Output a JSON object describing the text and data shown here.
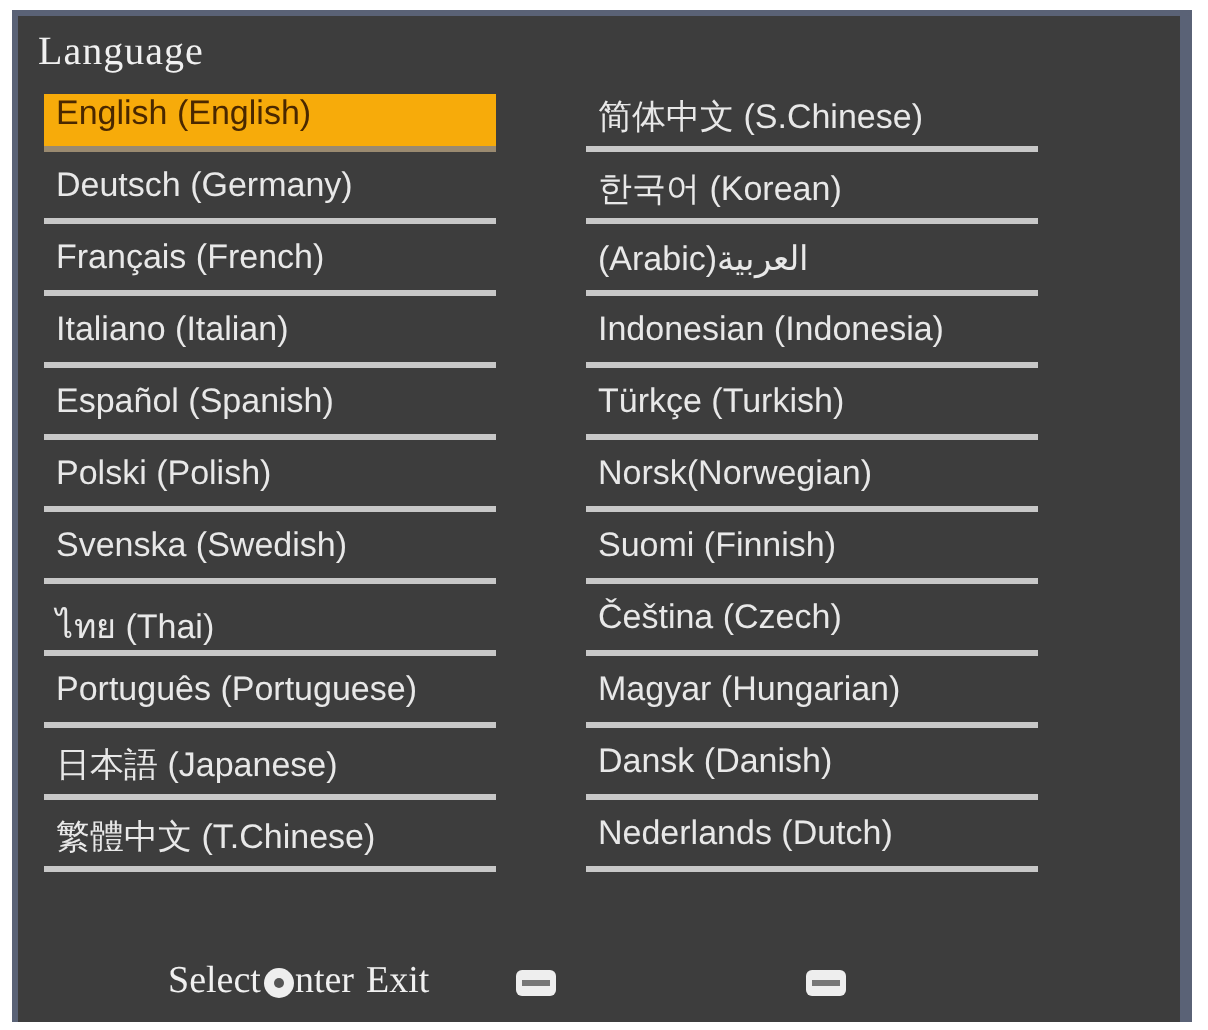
{
  "window": {
    "title": "Language"
  },
  "columns": [
    {
      "items": [
        {
          "label": "English (English)",
          "selected": true
        },
        {
          "label": "Deutsch (Germany)",
          "selected": false
        },
        {
          "label": "Français (French)",
          "selected": false
        },
        {
          "label": "Italiano (Italian)",
          "selected": false
        },
        {
          "label": "Español (Spanish)",
          "selected": false
        },
        {
          "label": "Polski (Polish)",
          "selected": false
        },
        {
          "label": "Svenska (Swedish)",
          "selected": false
        },
        {
          "label": "ไทย (Thai)",
          "selected": false
        },
        {
          "label": "Português (Portuguese)",
          "selected": false
        },
        {
          "label": "日本語 (Japanese)",
          "selected": false
        },
        {
          "label": "繁體中文 (T.Chinese)",
          "selected": false
        }
      ]
    },
    {
      "items": [
        {
          "label": "简体中文 (S.Chinese)",
          "selected": false
        },
        {
          "label": "한국어 (Korean)",
          "selected": false
        },
        {
          "label": "(Arabic)العربية",
          "selected": false
        },
        {
          "label": "Indonesian (Indonesia)",
          "selected": false
        },
        {
          "label": "Türkçe (Turkish)",
          "selected": false
        },
        {
          "label": "Norsk(Norwegian)",
          "selected": false
        },
        {
          "label": "Suomi (Finnish)",
          "selected": false
        },
        {
          "label": "Čeština (Czech)",
          "selected": false
        },
        {
          "label": "Magyar (Hungarian)",
          "selected": false
        },
        {
          "label": "Dansk (Danish)",
          "selected": false
        },
        {
          "label": "Nederlands (Dutch)",
          "selected": false
        }
      ]
    }
  ],
  "footer": {
    "select_label": "Select",
    "enter_label": "nter",
    "exit_label": "Exit"
  }
}
